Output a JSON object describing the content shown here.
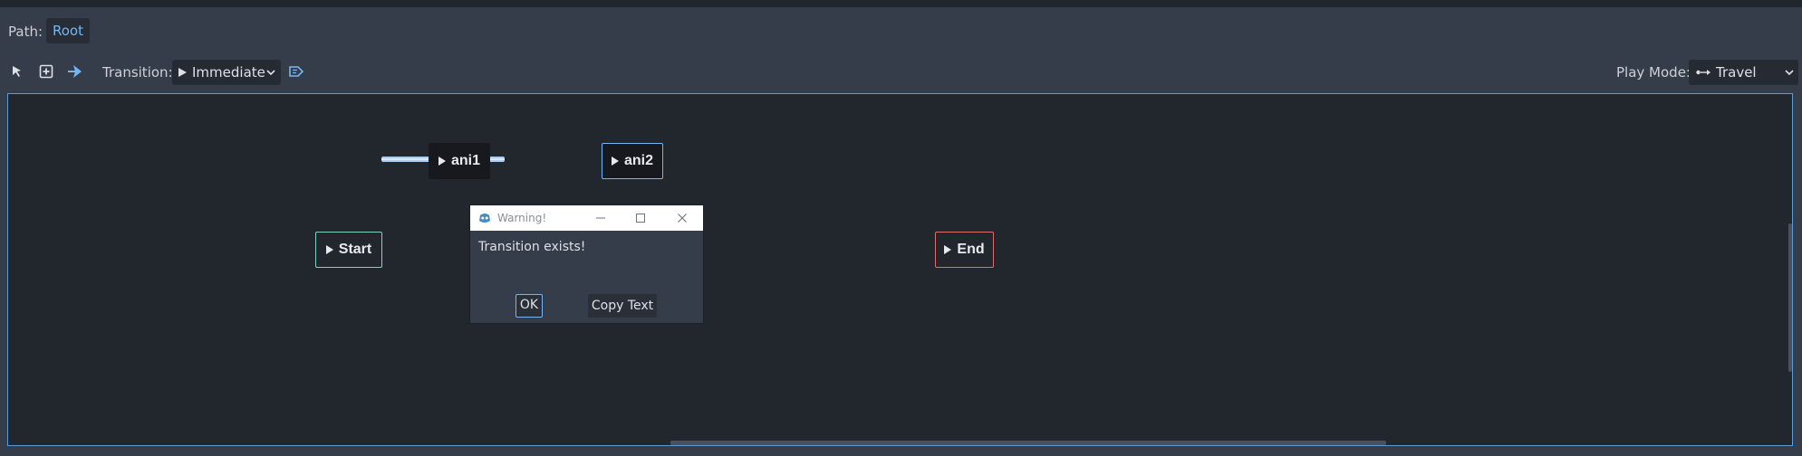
{
  "path_bar": {
    "label": "Path:",
    "root": "Root"
  },
  "toolbar": {
    "tools": [
      {
        "name": "select-tool",
        "icon": "pointer-icon"
      },
      {
        "name": "create-node-tool",
        "icon": "add-node-icon"
      },
      {
        "name": "connect-tool",
        "icon": "connect-icon"
      }
    ],
    "transition_label": "Transition:",
    "transition_value": "Immediate",
    "autoadvance_icon": "tag-icon",
    "play_mode_label": "Play Mode:",
    "play_mode_value": "Travel"
  },
  "graph": {
    "nodes": [
      {
        "name": "ani1",
        "label": "ani1",
        "kind": "animation"
      },
      {
        "name": "ani2",
        "label": "ani2",
        "kind": "animation",
        "selected": true
      },
      {
        "name": "start",
        "label": "Start",
        "kind": "start"
      },
      {
        "name": "end",
        "label": "End",
        "kind": "end"
      }
    ],
    "transitions": [
      {
        "from": "ani1",
        "to": "ani2"
      }
    ]
  },
  "dialog": {
    "title": "Warning!",
    "message": "Transition exists!",
    "ok": "OK",
    "copy": "Copy Text"
  },
  "colors": {
    "accent": "#74b6f5",
    "start_border": "#7fd1c5",
    "end_border": "#e06c6c",
    "transition_arrow": "#7cc34a",
    "transition_line": "#a9cdf0"
  }
}
